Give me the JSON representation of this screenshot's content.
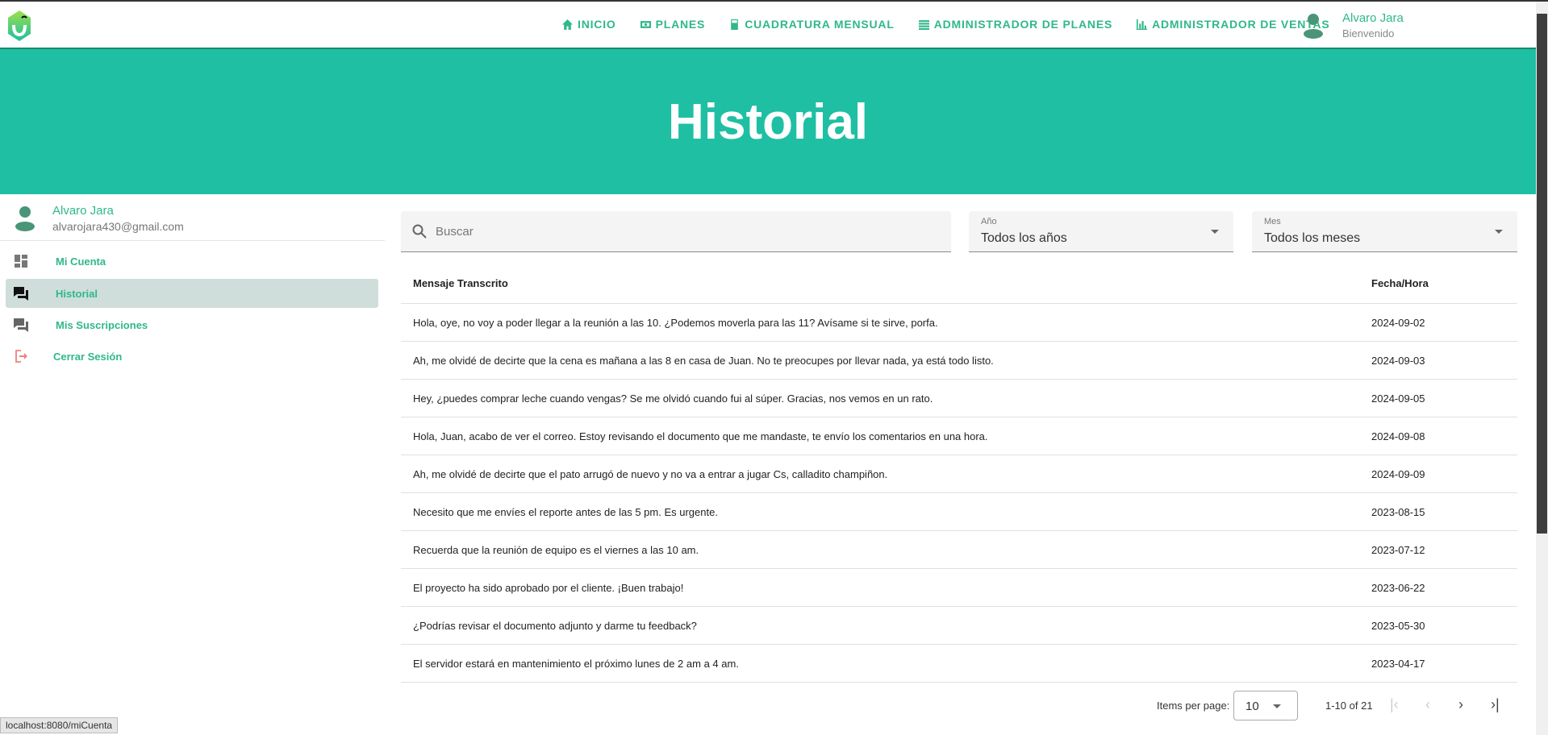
{
  "nav": {
    "links": [
      {
        "label": "INICIO",
        "icon": "home-icon"
      },
      {
        "label": "PLANES",
        "icon": "money-icon"
      },
      {
        "label": "CUADRATURA MENSUAL",
        "icon": "calculator-icon"
      },
      {
        "label": "ADMINISTRADOR DE PLANES",
        "icon": "list-icon"
      },
      {
        "label": "ADMINISTRADOR DE VENTAS",
        "icon": "bar-chart-icon"
      }
    ],
    "user_name": "Alvaro Jara",
    "user_greeting": "Bienvenido"
  },
  "hero": {
    "title": "Historial"
  },
  "sidebar": {
    "user_name": "Alvaro Jara",
    "user_email": "alvarojara430@gmail.com",
    "items": [
      {
        "label": "Mi Cuenta"
      },
      {
        "label": "Historial"
      },
      {
        "label": "Mis Suscripciones"
      },
      {
        "label": "Cerrar Sesión"
      }
    ]
  },
  "filters": {
    "search_placeholder": "Buscar",
    "year_label": "Año",
    "year_value": "Todos los años",
    "month_label": "Mes",
    "month_value": "Todos los meses"
  },
  "table": {
    "headers": {
      "message": "Mensaje Transcrito",
      "date": "Fecha/Hora"
    },
    "rows": [
      {
        "message": "Hola, oye, no voy a poder llegar a la reunión a las 10. ¿Podemos moverla para las 11? Avísame si te sirve, porfa.",
        "date": "2024-09-02"
      },
      {
        "message": "Ah, me olvidé de decirte que la cena es mañana a las 8 en casa de Juan. No te preocupes por llevar nada, ya está todo listo.",
        "date": "2024-09-03"
      },
      {
        "message": "Hey, ¿puedes comprar leche cuando vengas? Se me olvidó cuando fui al súper. Gracias, nos vemos en un rato.",
        "date": "2024-09-05"
      },
      {
        "message": "Hola, Juan, acabo de ver el correo. Estoy revisando el documento que me mandaste, te envío los comentarios en una hora.",
        "date": "2024-09-08"
      },
      {
        "message": "Ah, me olvidé de decirte que el pato arrugó de nuevo y no va a entrar a jugar Cs, calladito champiñon.",
        "date": "2024-09-09"
      },
      {
        "message": "Necesito que me envíes el reporte antes de las 5 pm. Es urgente.",
        "date": "2023-08-15"
      },
      {
        "message": "Recuerda que la reunión de equipo es el viernes a las 10 am.",
        "date": "2023-07-12"
      },
      {
        "message": "El proyecto ha sido aprobado por el cliente. ¡Buen trabajo!",
        "date": "2023-06-22"
      },
      {
        "message": "¿Podrías revisar el documento adjunto y darme tu feedback?",
        "date": "2023-05-30"
      },
      {
        "message": "El servidor estará en mantenimiento el próximo lunes de 2 am a 4 am.",
        "date": "2023-04-17"
      }
    ]
  },
  "pagination": {
    "items_per_page_label": "Items per page:",
    "items_per_page": "10",
    "range": "1-10 of 21"
  },
  "status_bar": "localhost:8080/miCuenta"
}
